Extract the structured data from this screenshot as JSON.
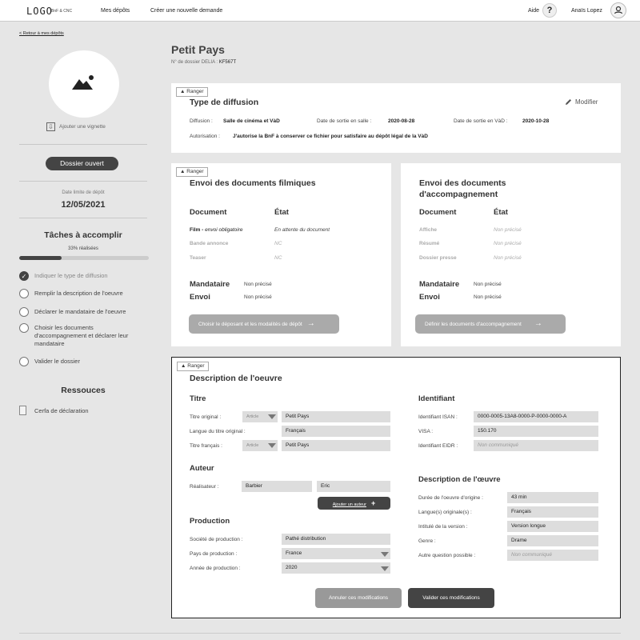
{
  "header": {
    "logo": "LOGO",
    "logo_sub": "BnF & CNC",
    "nav_deposits": "Mes dépôts",
    "nav_new_request": "Créer une nouvelle demande",
    "help": "Aide",
    "help_icon": "?",
    "user_name": "Anaïs Lopez"
  },
  "sidebar": {
    "back_link": "< Retour à mes dépôts",
    "add_thumbnail": "Ajouter une vignette",
    "status": "Dossier ouvert",
    "deadline_label": "Date limite de dépôt",
    "deadline": "12/05/2021",
    "tasks_title": "Tâches à accomplir",
    "progress_label": "33% réalisées",
    "progress_fraction": 0.33,
    "tasks": [
      {
        "label": "Indiquer le type de diffusion",
        "done": true
      },
      {
        "label": "Remplir la description de l'oeuvre",
        "done": false
      },
      {
        "label": "Déclarer le mandataire de l'oeuvre",
        "done": false
      },
      {
        "label": "Choisir les documents d'accompagnement et déclarer leur mandataire",
        "done": false
      },
      {
        "label": "Valider le dossier",
        "done": false
      }
    ],
    "resources_title": "Ressouces",
    "resource_doc": "Cerfa de déclaration"
  },
  "page": {
    "title": "Petit Pays",
    "file_label": "N° de dossier DELIA :",
    "file_number": "KF567T"
  },
  "ranger": "Ranger",
  "diffusion": {
    "title": "Type de diffusion",
    "modify": "Modifier",
    "diffusion_label": "Diffusion :",
    "diffusion_value": "Salle de cinéma et VàD",
    "release_label": "Date de sortie en salle :",
    "release_value": "2020-08-28",
    "vod_label": "Date de sortie en VàD :",
    "vod_value": "2020-10-28",
    "authorization_label": "Autorisation :",
    "authorization_value": "J'autorise la BnF à conserver ce fichier pour satisfaire au dépôt légal de la VàD"
  },
  "film_docs": {
    "title": "Envoi des documents filmiques",
    "col_document": "Document",
    "col_state": "État",
    "rows": [
      {
        "doc_bold": "Film - ",
        "doc_ital": "envoi obligatoire",
        "state": "En attente du document",
        "muted": false
      },
      {
        "doc_bold": "Bande annonce",
        "doc_ital": "",
        "state": "NC",
        "muted": true
      },
      {
        "doc_bold": "Teaser",
        "doc_ital": "",
        "state": "NC",
        "muted": true
      }
    ],
    "mandataire_label": "Mandataire",
    "mandataire_value": "Non précisé",
    "envoi_label": "Envoi",
    "envoi_value": "Non précisé",
    "button": "Choisir le déposant et les modalités de dépôt"
  },
  "accomp_docs": {
    "title_line1": "Envoi des documents",
    "title_line2": "d'accompagnement",
    "col_document": "Document",
    "col_state": "État",
    "rows": [
      {
        "doc": "Affiche",
        "state": "Non précisé"
      },
      {
        "doc": "Résumé",
        "state": "Non précisé"
      },
      {
        "doc": "Dossier presse",
        "state": "Non précisé"
      }
    ],
    "mandataire_label": "Mandataire",
    "mandataire_value": "Non précisé",
    "envoi_label": "Envoi",
    "envoi_value": "Non précisé",
    "button": "Définir les documents d'accompagnement"
  },
  "description": {
    "title": "Description de l'oeuvre",
    "titre_heading": "Titre",
    "titre_original_label": "Titre original :",
    "article_placeholder": "Article",
    "titre_original_value": "Petit Pays",
    "langue_label": "Langue du titre original :",
    "langue_value": "Français",
    "titre_fr_label": "Titre français :",
    "titre_fr_value": "Petit Pays",
    "auteur_heading": "Auteur",
    "realisateur_label": "Réalisateur :",
    "realisateur_last": "Barbier",
    "realisateur_first": "Eric",
    "add_author": "Ajouter un auteur",
    "production_heading": "Production",
    "societe_label": "Société de production :",
    "societe_value": "Pathé distribution",
    "pays_label": "Pays de production :",
    "pays_value": "France",
    "annee_label": "Année de production :",
    "annee_value": "2020",
    "identifiant_heading": "Identifiant",
    "isan_label": "Identifiant ISAN :",
    "isan_value": "0000-0005-13A8-0000-P-0000-0000-A",
    "visa_label": "VISA :",
    "visa_value": "150.170",
    "eidr_label": "Identifiant EIDR :",
    "eidr_value": "Non communiqué",
    "oeuvre_heading": "Description de l'œuvre",
    "duree_label": "Durée de l'oeuvre d'origine :",
    "duree_value": "43 min",
    "langues_label": "Langue(s) originale(s) :",
    "langues_value": "Français",
    "version_label": "Intitulé de la version :",
    "version_value": "Version longue",
    "genre_label": "Genre :",
    "genre_value": "Drame",
    "autre_label": "Autre question possible :",
    "autre_value": "Non communiqué",
    "cancel_button": "Annuler ces modifications",
    "validate_button": "Valider ces modifications"
  }
}
